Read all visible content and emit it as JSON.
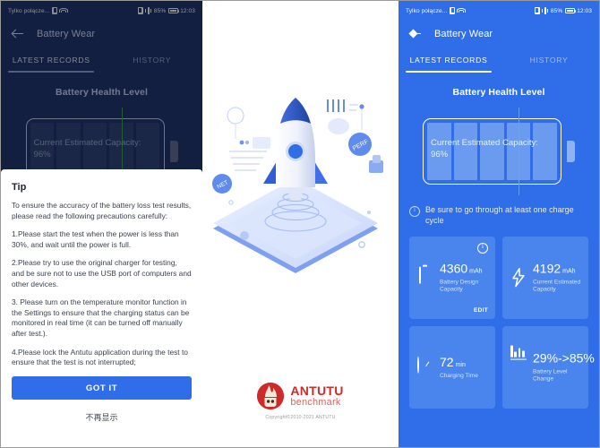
{
  "status_bar": {
    "carrier": "Tylko połącze...",
    "battery_percent": "85%",
    "time": "12:03",
    "icons": [
      "sim-card-icon",
      "wifi-icon",
      "nfc-icon",
      "vibrate-icon",
      "battery-icon"
    ]
  },
  "app_bar": {
    "back_icon": "back-arrow-icon",
    "title": "Battery Wear"
  },
  "tabs": [
    {
      "label": "LATEST RECORDS",
      "active": true
    },
    {
      "label": "HISTORY",
      "active": false
    }
  ],
  "main": {
    "section_title": "Battery Health Level",
    "battery_capacity_label": "Current Estimated Capacity: 96%",
    "battery_percent_value": "96%",
    "info_note": "Be sure to go through at least one charge cycle",
    "cards": [
      {
        "icon": "battery-icon",
        "value": "4360",
        "unit": "mAh",
        "label": "Battery Design Capacity",
        "corner_action": "EDIT",
        "has_info_icon": true
      },
      {
        "icon": "lightning-bolt-icon",
        "value": "4192",
        "unit": "mAh",
        "label": "Current Estimated Capacity",
        "corner_action": "",
        "has_info_icon": false
      },
      {
        "icon": "gauge-icon",
        "value": "72",
        "unit": "min",
        "label": "Charging Time",
        "corner_action": "",
        "has_info_icon": false
      },
      {
        "icon": "bar-chart-icon",
        "value": "29%->85%",
        "unit": "",
        "label": "Battery Level Change",
        "corner_action": "",
        "has_info_icon": false
      }
    ]
  },
  "dialog": {
    "title": "Tip",
    "paragraphs": [
      "To ensure the accuracy of the battery loss test results, please read the following precautions carefully:",
      "1.Please start the test when the power is less than 30%, and wait until the power is full.",
      "2.Please try to use the original charger for testing, and be sure not to use the USB port of computers and other devices.",
      "3. Please turn on the temperature monitor function in the Settings to ensure that the charging status can be monitored in real time (it can be turned off manually after test.).",
      "4.Please lock the Antutu application during the test to ensure that the test is not interrupted;"
    ],
    "primary_button": "GOT IT",
    "secondary_link": "不再显示"
  },
  "illustration": {
    "name": "rocket-on-phone-illustration",
    "badges": [
      "NET",
      "PERF"
    ]
  },
  "branding": {
    "logo_name": "antutu-logo",
    "title": "ANTUTU",
    "subtitle": "benchmark",
    "copyright": "Copyright©2010-2021 ANTUTU"
  },
  "colors": {
    "brand_blue": "#2f6ee8",
    "dark_navy": "#1c2f5e",
    "card_blue": "#4a85ee",
    "antutu_red": "#cf2a27",
    "scan_green": "#45d163"
  }
}
